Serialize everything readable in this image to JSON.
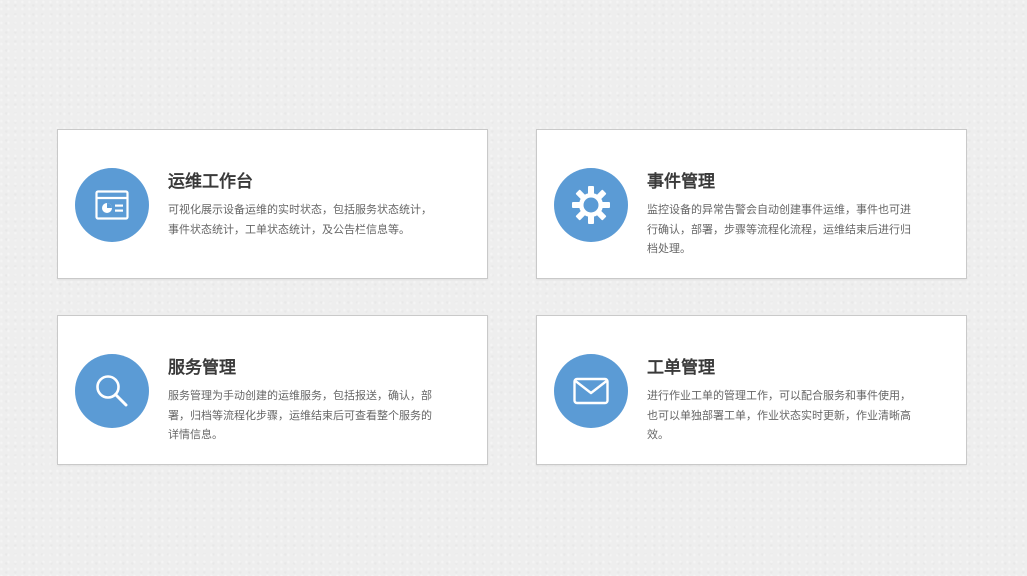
{
  "theme": {
    "accent": "#5b9bd5",
    "card_background": "#ffffff",
    "page_background": "#eeeeee"
  },
  "cards": [
    {
      "icon": "dashboard-window-icon",
      "title": "运维工作台",
      "description": "可视化展示设备运维的实时状态，包括服务状态统计，事件状态统计，工单状态统计，及公告栏信息等。"
    },
    {
      "icon": "gear-icon",
      "title": "事件管理",
      "description": "监控设备的异常告警会自动创建事件运维，事件也可进行确认，部署，步骤等流程化流程，运维结束后进行归档处理。"
    },
    {
      "icon": "search-icon",
      "title": "服务管理",
      "description": "服务管理为手动创建的运维服务，包括报送，确认，部署，归档等流程化步骤，运维结束后可查看整个服务的详情信息。"
    },
    {
      "icon": "envelope-icon",
      "title": "工单管理",
      "description": "进行作业工单的管理工作，可以配合服务和事件使用，也可以单独部署工单，作业状态实时更新，作业清晰高效。"
    }
  ]
}
